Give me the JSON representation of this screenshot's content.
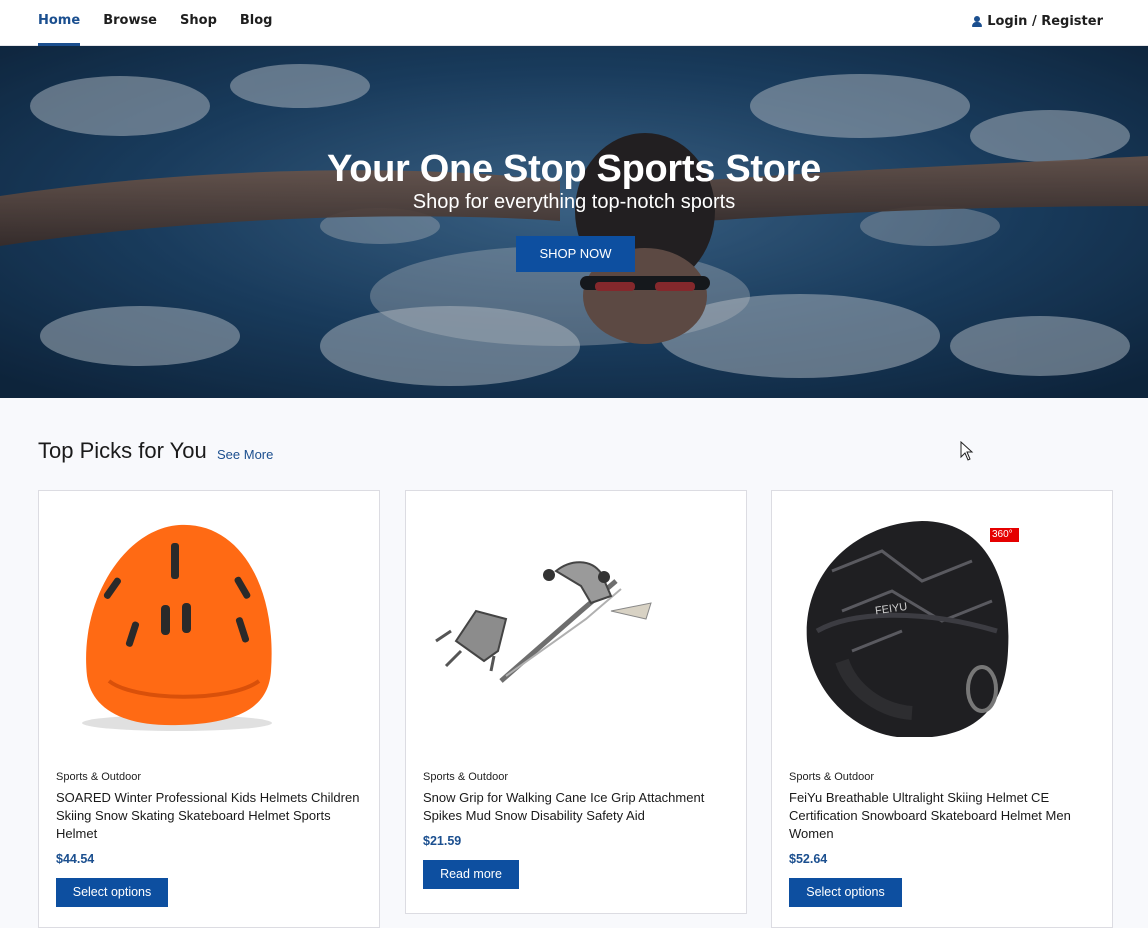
{
  "nav": {
    "links": [
      "Home",
      "Browse",
      "Shop",
      "Blog"
    ],
    "active": "Home",
    "login_label": "Login / Register",
    "login_icon": "user-icon"
  },
  "hero": {
    "title": "Your One Stop Sports Store",
    "subtitle": "Shop for everything top-notch sports",
    "button_label": "SHOP NOW"
  },
  "section": {
    "title": "Top Picks for You",
    "see_more": "See More"
  },
  "products": [
    {
      "category": "Sports & Outdoor",
      "title": "SOARED Winter Professional Kids Helmets Children Skiing Snow Skating Skateboard Helmet Sports Helmet",
      "price": "$44.54",
      "button": "Select options"
    },
    {
      "category": "Sports & Outdoor",
      "title": "Snow Grip for Walking Cane Ice Grip Attachment Spikes Mud Snow Disability Safety Aid",
      "price": "$21.59",
      "button": "Read more"
    },
    {
      "category": "Sports & Outdoor",
      "title": "FeiYu Breathable Ultralight Skiing Helmet CE Certification Snowboard Skateboard Helmet Men Women",
      "price": "$52.64",
      "button": "Select options",
      "badge": "360°",
      "helmet_logo": "FEIYU"
    }
  ],
  "colors": {
    "accent": "#1b4f8f",
    "button": "#0d4fa0",
    "badge": "#e50000"
  }
}
